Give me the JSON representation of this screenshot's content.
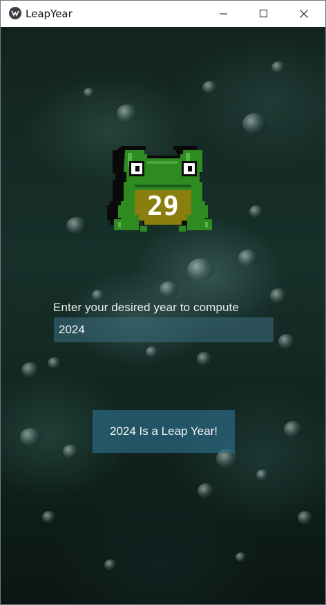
{
  "window": {
    "title": "LeapYear"
  },
  "titlebar": {
    "app_icon": "kivy-logo-icon",
    "minimize_icon": "minimize-icon",
    "maximize_icon": "maximize-icon",
    "close_icon": "close-icon"
  },
  "frog": {
    "badge_number": "29",
    "icon": "pixel-frog-icon"
  },
  "form": {
    "prompt": "Enter your desired year to compute",
    "year_value": "2024",
    "result_label": "2024 Is a Leap Year!"
  },
  "colors": {
    "frog_green": "#2e8b22",
    "frog_belly": "#8a7f0e",
    "input_bg": "#3c6e82",
    "button_bg": "#2d6e8c"
  }
}
